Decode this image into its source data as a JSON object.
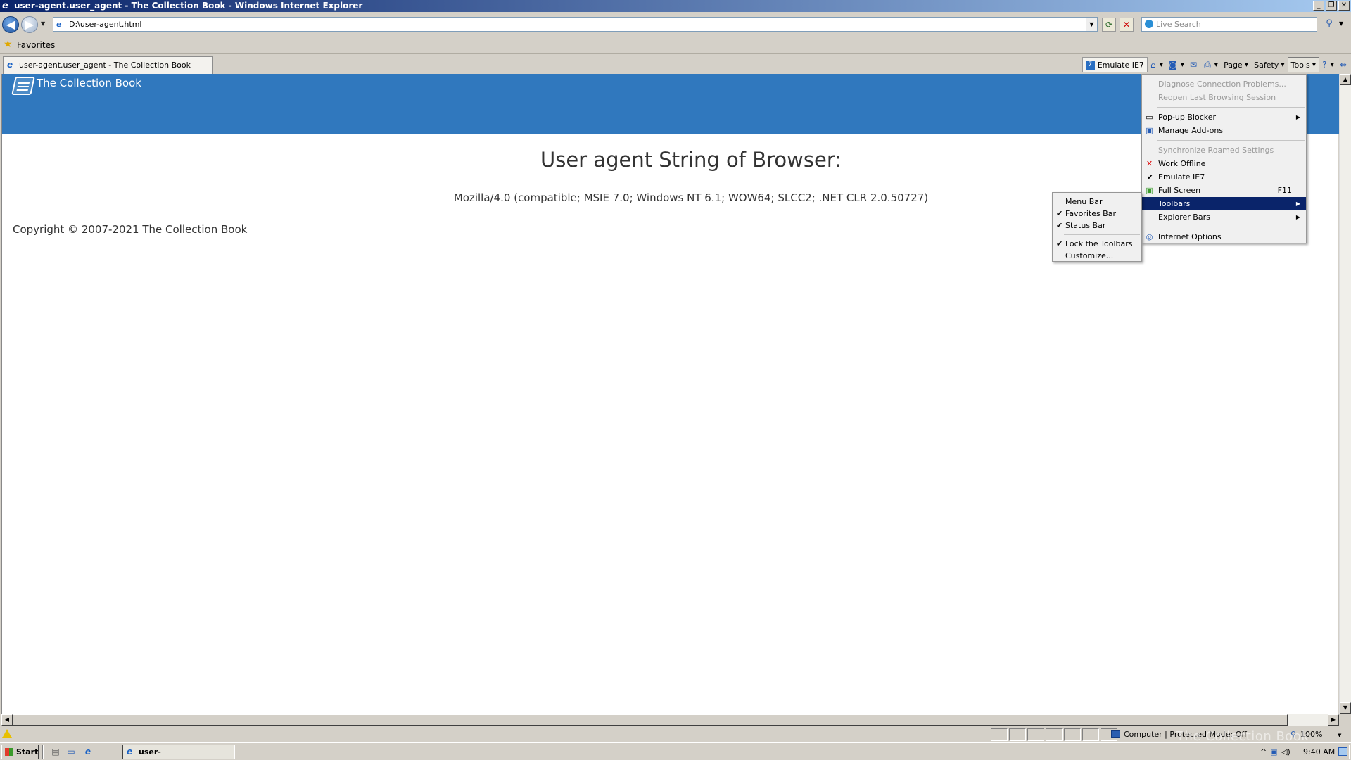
{
  "window": {
    "title": "user-agent.user_agent - The Collection Book - Windows Internet Explorer",
    "buttons": {
      "minimize": "_",
      "restore": "❐",
      "close": "✕"
    }
  },
  "address": {
    "url": "D:\\user-agent.html",
    "search_placeholder": "Live Search"
  },
  "favorites": {
    "label": "Favorites"
  },
  "tab": {
    "title": "user-agent.user_agent - The Collection Book"
  },
  "commandbar": {
    "emulate": "Emulate IE7",
    "page": "Page",
    "safety": "Safety",
    "tools": "Tools"
  },
  "site": {
    "title": "The Collection Book",
    "heading": "User agent String of Browser:",
    "ua_string": "Mozilla/4.0 (compatible; MSIE 7.0; Windows NT 6.1; WOW64; SLCC2; .NET CLR 2.0.50727)",
    "copyright": "Copyright © 2007-2021 The Collection Book"
  },
  "tools_menu": {
    "items": [
      {
        "label": "Diagnose Connection Problems..."
      },
      {
        "label": "Reopen Last Browsing Session"
      },
      {
        "label": "Pop-up Blocker"
      },
      {
        "label": "Manage Add-ons"
      },
      {
        "label": "Synchronize Roamed Settings"
      },
      {
        "label": "Work Offline"
      },
      {
        "label": "Emulate IE7"
      },
      {
        "label": "Full Screen",
        "shortcut": "F11"
      },
      {
        "label": "Toolbars"
      },
      {
        "label": "Explorer Bars"
      },
      {
        "label": "Internet Options"
      }
    ]
  },
  "toolbars_menu": {
    "items": [
      {
        "label": "Menu Bar"
      },
      {
        "label": "Favorites Bar"
      },
      {
        "label": "Status Bar"
      },
      {
        "label": "Lock the Toolbars"
      },
      {
        "label": "Customize..."
      }
    ]
  },
  "statusbar": {
    "zone": "Computer | Protected Mode: Off",
    "zoom": "100%"
  },
  "taskbar": {
    "start": "Start",
    "task": "user-agent.user_age...",
    "clock": "9:40 AM"
  },
  "watermark": "The Collection Book"
}
